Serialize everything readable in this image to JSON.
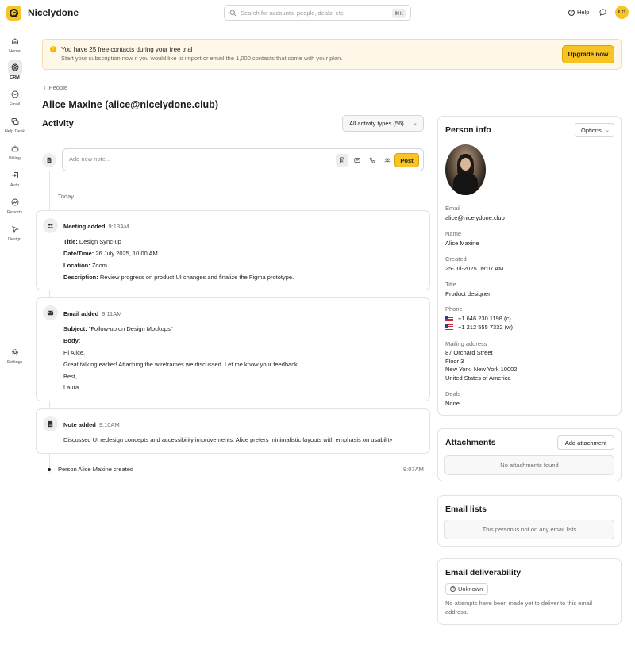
{
  "app": {
    "name": "Nicelydone"
  },
  "search": {
    "placeholder": "Search for accounts, people, deals, etc",
    "shortcut": "⌘K"
  },
  "header": {
    "help_label": "Help",
    "avatar_initials": "LO"
  },
  "sidebar": {
    "items": [
      {
        "label": "Home",
        "icon": "home-icon"
      },
      {
        "label": "CRM",
        "icon": "crm-icon",
        "active": true
      },
      {
        "label": "Email",
        "icon": "email-icon"
      },
      {
        "label": "Help Desk",
        "icon": "help-desk-icon"
      },
      {
        "label": "Billing",
        "icon": "billing-icon"
      },
      {
        "label": "Auth",
        "icon": "auth-icon"
      },
      {
        "label": "Reports",
        "icon": "reports-icon"
      },
      {
        "label": "Design",
        "icon": "design-icon"
      },
      {
        "label": "Settings",
        "icon": "settings-icon"
      }
    ]
  },
  "banner": {
    "title": "You have 25 free contacts during your free trial",
    "text": "Start your subscription now if you would like to import or email the 1,000 contacts that come with your plan.",
    "button": "Upgrade now"
  },
  "breadcrumb": {
    "label": "People"
  },
  "page": {
    "title": "Alice Maxine (alice@nicelydone.club)"
  },
  "activity": {
    "title": "Activity",
    "filter_label": "All activity types (56)",
    "note_placeholder": "Add new note...",
    "post_label": "Post",
    "date_group": "Today",
    "meeting": {
      "type": "Meeting added",
      "time": "9:13AM",
      "title_label": "Title:",
      "title_value": "Design Sync-up",
      "datetime_label": "Date/Time:",
      "datetime_value": "26 July 2025, 10:00 AM",
      "location_label": "Location:",
      "location_value": "Zoom",
      "description_label": "Description:",
      "description_value": "Review progress on product UI changes and finalize the Figma prototype."
    },
    "email": {
      "type": "Email added",
      "time": "9:11AM",
      "subject_label": "Subject:",
      "subject_value": "\"Follow-up on Design Mockups\"",
      "body_label": "Body:",
      "body_lines": [
        "Hi Alice,",
        "Great talking earlier! Attaching the wireframes we discussed. Let me know your feedback.",
        "Best,",
        "Laura"
      ]
    },
    "note": {
      "type": "Note added",
      "time": "9:10AM",
      "text": "Discussed UI redesign concepts and accessibility improvements. Alice prefers minimalistic layouts with emphasis on usability"
    },
    "created": {
      "text": "Person Alice Maxine created",
      "time": "9:07AM"
    }
  },
  "person_info": {
    "title": "Person info",
    "options_label": "Options",
    "email_label": "Email",
    "email_value": "alice@nicelydone.club",
    "name_label": "Name",
    "name_value": "Alice Maxine",
    "created_label": "Created",
    "created_value": "25-Jul-2025 09:07 AM",
    "title_label": "Title",
    "title_value": "Product designer",
    "phone_label": "Phone",
    "phones": [
      "+1 646 230 1198 (c)",
      "+1 212 555 7332 (w)"
    ],
    "address_label": "Mailing address",
    "address_lines": [
      "87 Orchard Street",
      "Floor 3",
      "New York, New York  10002",
      "United States of America"
    ],
    "deals_label": "Deals",
    "deals_value": "None"
  },
  "attachments": {
    "title": "Attachments",
    "button": "Add attachment",
    "empty": "No attachments found"
  },
  "email_lists": {
    "title": "Email lists",
    "empty": "This person is not on any email lists"
  },
  "deliverability": {
    "title": "Email deliverability",
    "status": "Unknown",
    "text": "No attempts have been made yet to deliver to this email address."
  },
  "colors": {
    "accent": "#f7c325",
    "banner_bg": "#fff8e8"
  }
}
